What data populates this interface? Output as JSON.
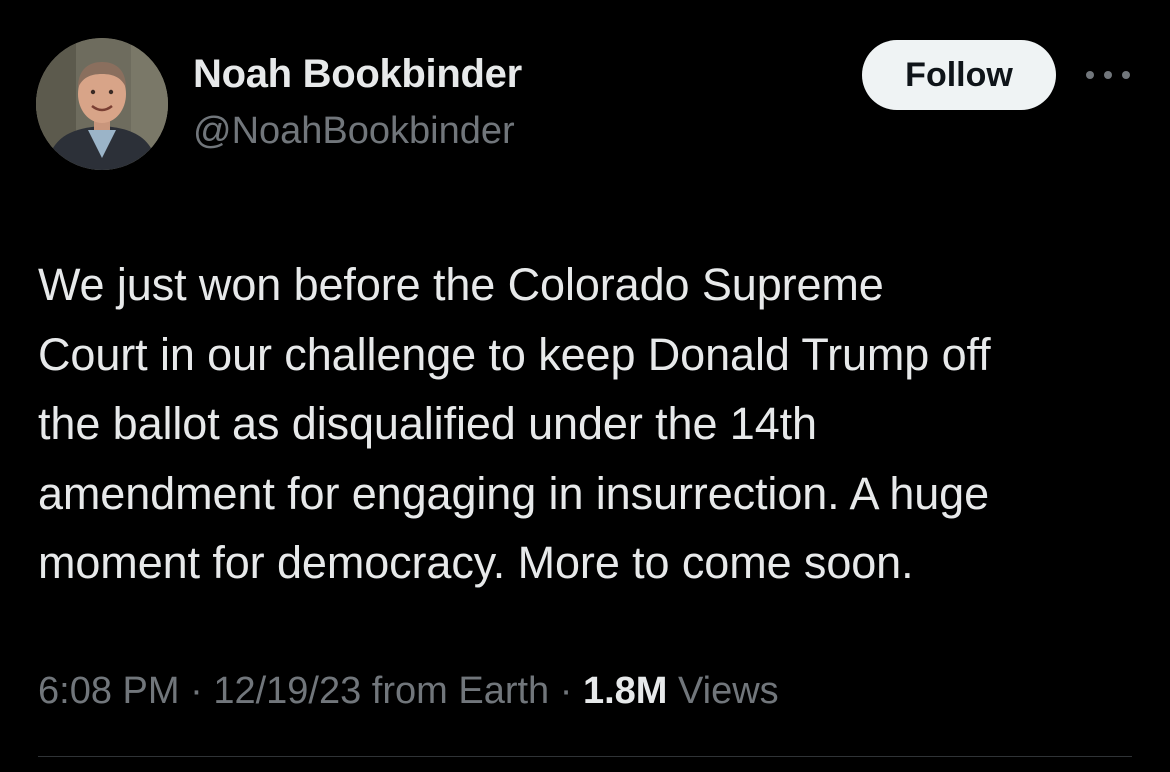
{
  "author": {
    "display_name": "Noah Bookbinder",
    "handle": "@NoahBookbinder"
  },
  "actions": {
    "follow_label": "Follow",
    "more_icon": "more-horizontal-icon"
  },
  "tweet": {
    "text": "We just won before the Colorado Supreme\nCourt in our challenge to keep Donald Trump off\nthe ballot as disqualified under the 14th\namendment for engaging in insurrection. A huge\nmoment for democracy. More to come soon.",
    "time": "6:08 PM",
    "separator": " · ",
    "date_source": "12/19/23 from Earth",
    "views_count": "1.8M",
    "views_label": " Views"
  },
  "colors": {
    "background": "#000000",
    "primary_text": "#e7e9ea",
    "secondary_text": "#71767b",
    "follow_bg": "#eff3f4",
    "divider": "#2f3336"
  }
}
